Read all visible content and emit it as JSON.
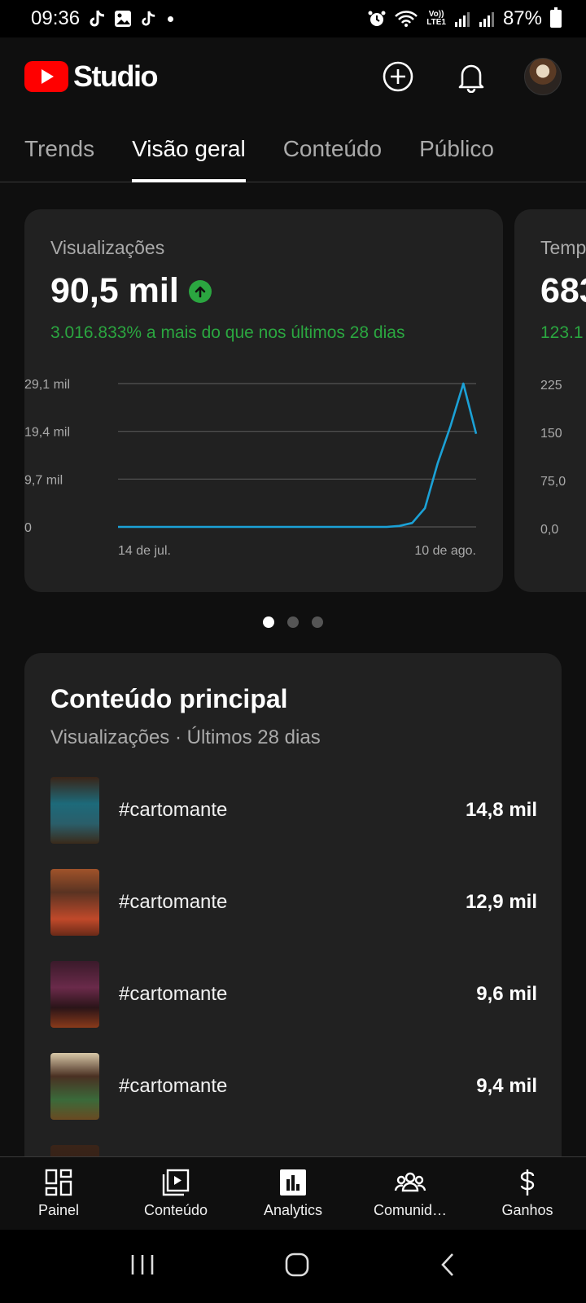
{
  "status_bar": {
    "time": "09:36",
    "battery": "87%",
    "lte_top": "Vo))",
    "lte_bottom": "LTE1"
  },
  "header": {
    "logo_text": "Studio"
  },
  "tabs": [
    {
      "label": "Trends",
      "active": false
    },
    {
      "label": "Visão geral",
      "active": true
    },
    {
      "label": "Conteúdo",
      "active": false
    },
    {
      "label": "Público",
      "active": false
    }
  ],
  "metric_card": {
    "label": "Visualizações",
    "value": "90,5 mil",
    "change": "3.016.833% a mais do que nos últimos 28 dias"
  },
  "peek_card": {
    "label": "Temp",
    "value": "683",
    "change": "123.1",
    "y_ticks": [
      "225",
      "150",
      "75,0",
      "0,0"
    ]
  },
  "chart_data": {
    "type": "line",
    "y_ticks": [
      "29,1 mil",
      "19,4 mil",
      "9,7 mil",
      "0"
    ],
    "x_labels": [
      "14 de jul.",
      "10 de ago."
    ],
    "ylim": [
      0,
      29100
    ],
    "values": [
      0,
      0,
      0,
      0,
      0,
      0,
      0,
      0,
      0,
      0,
      0,
      0,
      0,
      0,
      0,
      0,
      0,
      0,
      0,
      0,
      0,
      0,
      200,
      800,
      3800,
      13000,
      20500,
      29100,
      18900
    ],
    "color": "#1ba1d6"
  },
  "pagination": {
    "count": 3,
    "active": 0
  },
  "top_content": {
    "title": "Conteúdo principal",
    "subtitle": "Visualizações · Últimos 28 dias",
    "items": [
      {
        "title": "#cartomante",
        "value": "14,8 mil"
      },
      {
        "title": "#cartomante",
        "value": "12,9 mil"
      },
      {
        "title": "#cartomante",
        "value": "9,6 mil"
      },
      {
        "title": "#cartomante",
        "value": "9,4 mil"
      }
    ]
  },
  "bottom_nav": [
    {
      "label": "Painel",
      "icon": "dashboard-icon"
    },
    {
      "label": "Conteúdo",
      "icon": "content-icon"
    },
    {
      "label": "Analytics",
      "icon": "analytics-icon",
      "active": true
    },
    {
      "label": "Comunid…",
      "icon": "community-icon"
    },
    {
      "label": "Ganhos",
      "icon": "earnings-icon"
    }
  ]
}
